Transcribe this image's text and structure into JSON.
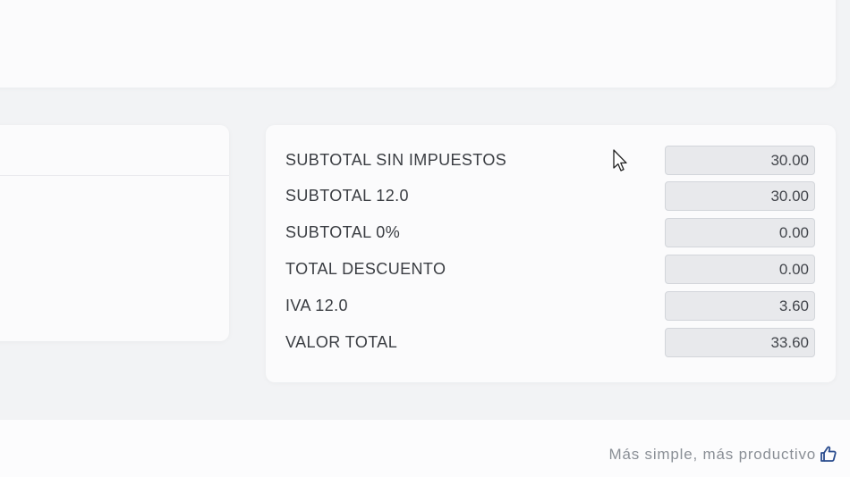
{
  "totals": {
    "rows": [
      {
        "label": "SUBTOTAL SIN IMPUESTOS",
        "value": "30.00"
      },
      {
        "label": "SUBTOTAL 12.0",
        "value": "30.00"
      },
      {
        "label": "SUBTOTAL 0%",
        "value": "0.00"
      },
      {
        "label": "TOTAL DESCUENTO",
        "value": "0.00"
      },
      {
        "label": "IVA 12.0",
        "value": "3.60"
      },
      {
        "label": "VALOR TOTAL",
        "value": "33.60"
      }
    ]
  },
  "footer": {
    "slogan": "Más simple, más productivo",
    "icon": "thumbs-up-icon"
  },
  "colors": {
    "background": "#f2f3f5",
    "card": "#fbfbfc",
    "field": "#e8e9ec",
    "thumb_icon": "#2b4d8f"
  }
}
